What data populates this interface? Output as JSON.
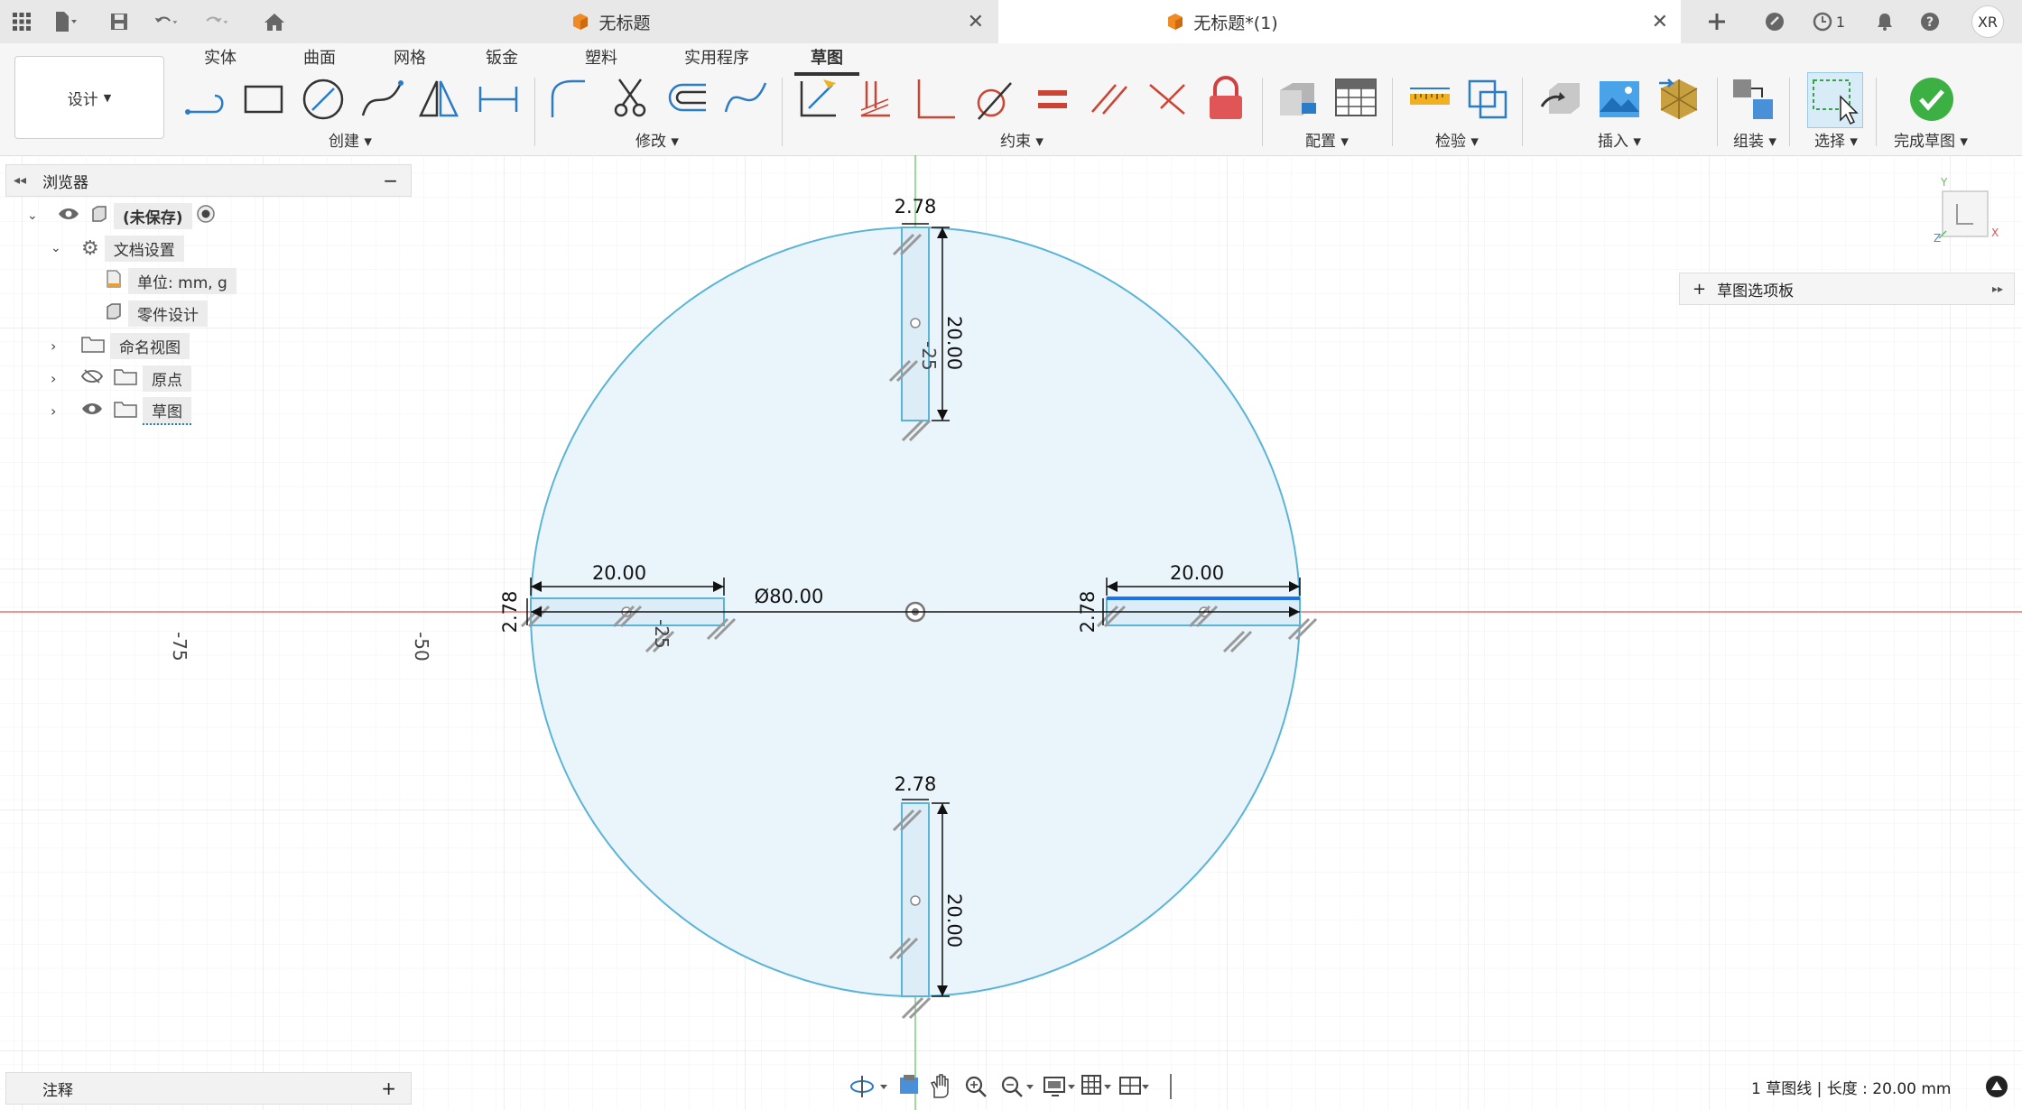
{
  "titlebar": {
    "tabs": [
      {
        "label": "无标题",
        "active": false
      },
      {
        "label": "无标题*(1)",
        "active": true
      }
    ],
    "notifications_count": "1",
    "user_initials": "XR"
  },
  "ribbon": {
    "workspace_label": "设计",
    "tabs": [
      "实体",
      "曲面",
      "网格",
      "钣金",
      "塑料",
      "实用程序",
      "草图"
    ],
    "active_tab": "草图",
    "groups": {
      "create": "创建",
      "modify": "修改",
      "constraints": "约束",
      "configure": "配置",
      "inspect": "检验",
      "insert": "插入",
      "assemble": "组装",
      "select": "选择",
      "finish": "完成草图"
    }
  },
  "browser": {
    "title": "浏览器",
    "root": "(未保存)",
    "doc_settings": "文档设置",
    "units": "单位: mm, g",
    "part_design": "零件设计",
    "named_views": "命名视图",
    "origin": "原点",
    "sketch": "草图"
  },
  "palette": {
    "label": "草图选项板"
  },
  "notes": {
    "label": "注释"
  },
  "status": {
    "text": "1 草图线 | 长度 : 20.00 mm"
  },
  "sketch": {
    "axis_labels": {
      "x_neg75": "-75",
      "x_neg50": "-50",
      "x_neg25": "-25",
      "y_neg25": "-25"
    },
    "dims": {
      "diameter": "Ø80.00",
      "top_width": "2.78",
      "top_length": "20.00",
      "bottom_width": "2.78",
      "bottom_length": "20.00",
      "left_length": "20.00",
      "left_width": "2.78",
      "right_length": "20.00",
      "right_width": "2.78"
    },
    "colors": {
      "circle": "#5ab4d8",
      "fill": "#eaf5fb",
      "x_axis": "#e05050",
      "y_axis": "#5cc05c",
      "selected": "#1a73e8"
    }
  }
}
